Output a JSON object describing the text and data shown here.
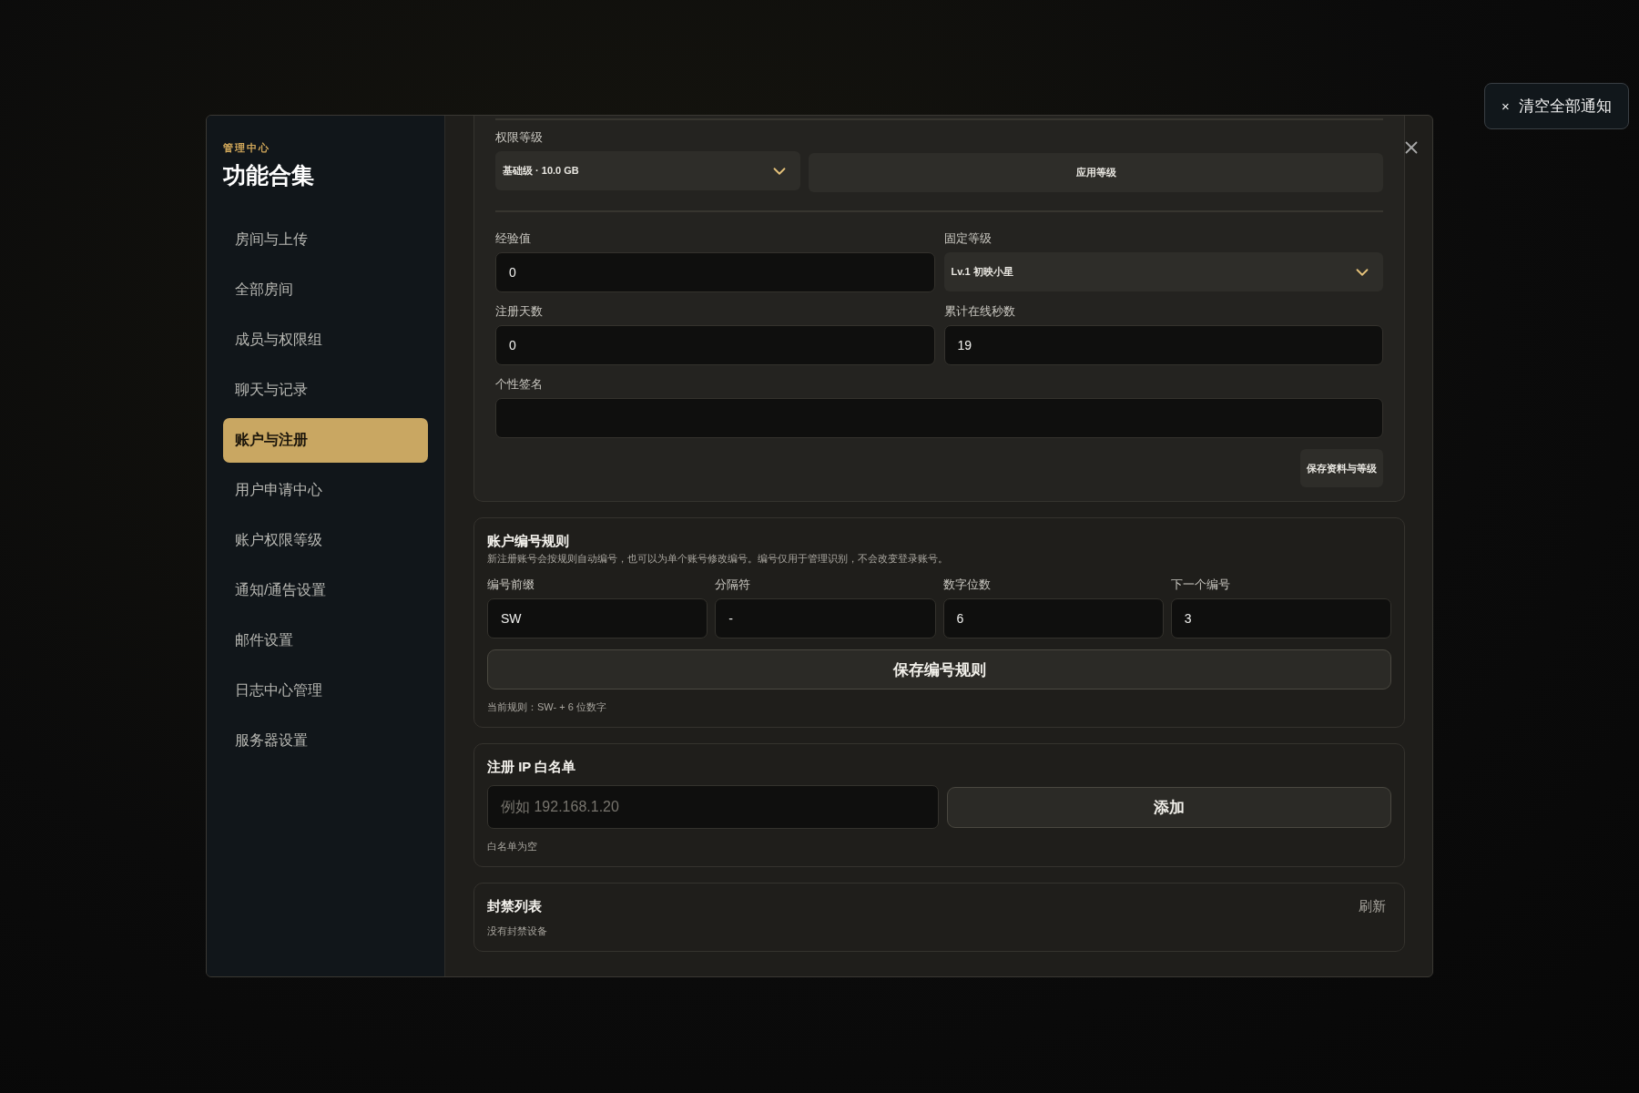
{
  "notification_button": {
    "icon": "×",
    "label": "清空全部通知"
  },
  "sidebar": {
    "eyebrow": "管理中心",
    "title": "功能合集",
    "items": [
      {
        "label": "房间与上传",
        "selected": false
      },
      {
        "label": "全部房间",
        "selected": false
      },
      {
        "label": "成员与权限组",
        "selected": false
      },
      {
        "label": "聊天与记录",
        "selected": false
      },
      {
        "label": "账户与注册",
        "selected": true
      },
      {
        "label": "用户申请中心",
        "selected": false
      },
      {
        "label": "账户权限等级",
        "selected": false
      },
      {
        "label": "通知/通告设置",
        "selected": false
      },
      {
        "label": "邮件设置",
        "selected": false
      },
      {
        "label": "日志中心管理",
        "selected": false
      },
      {
        "label": "服务器设置",
        "selected": false
      }
    ]
  },
  "profile_card": {
    "permission_label": "权限等级",
    "permission_value": "基础级 · 10.0 GB",
    "apply_button": "应用等级",
    "fields": [
      {
        "kind": "input",
        "label": "经验值",
        "value": "0",
        "wide": false
      },
      {
        "kind": "select",
        "label": "固定等级",
        "value": "Lv.1 初映小星",
        "wide": false
      },
      {
        "kind": "input",
        "label": "注册天数",
        "value": "0",
        "wide": false
      },
      {
        "kind": "input",
        "label": "累计在线秒数",
        "value": "19",
        "wide": false
      },
      {
        "kind": "input",
        "label": "个性签名",
        "wide": true
      }
    ],
    "save_button": "保存资料与等级"
  },
  "numbering_rule": {
    "title": "账户编号规则",
    "description": "新注册账号会按规则自动编号，也可以为单个账号修改编号。编号仅用于管理识别，不会改变登录账号。",
    "fields": [
      {
        "label": "编号前缀",
        "value": "SW"
      },
      {
        "label": "分隔符",
        "value": "-"
      },
      {
        "label": "数字位数",
        "value": "6"
      },
      {
        "label": "下一个编号",
        "value": "3"
      }
    ],
    "save_button": "保存编号规则",
    "current_rule": "当前规则：SW- + 6 位数字"
  },
  "ip_whitelist": {
    "title": "注册 IP 白名单",
    "placeholder": "例如 192.168.1.20",
    "add_button": "添加",
    "empty_text": "白名单为空"
  },
  "ban_list": {
    "title": "封禁列表",
    "refresh_button": "刷新",
    "empty_text": "没有封禁设备"
  }
}
